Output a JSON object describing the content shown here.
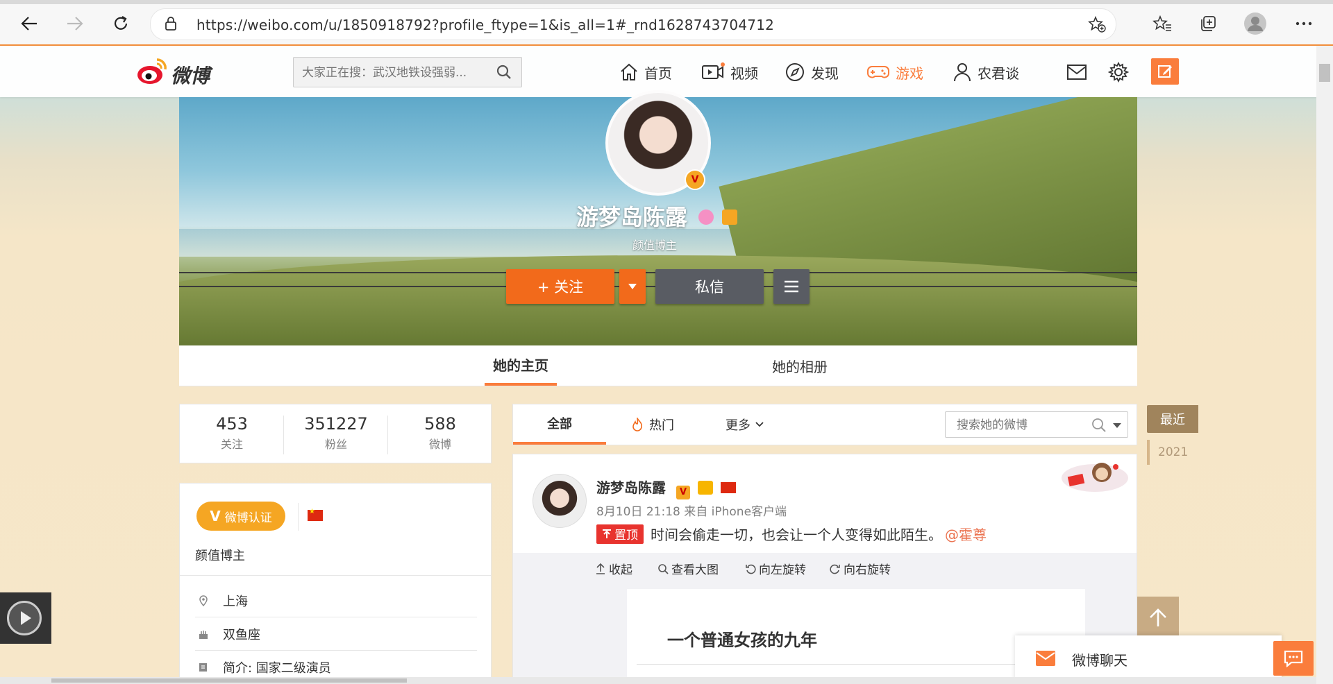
{
  "browser": {
    "url": "https://weibo.com/u/1850918792?profile_ftype=1&is_all=1#_rnd1628743704712"
  },
  "header": {
    "logo_text": "微博",
    "search_placeholder": "大家正在搜：武汉地铁设强弱...",
    "nav": {
      "home": "首页",
      "video": "视频",
      "discover": "发现",
      "game": "游戏",
      "user": "农君谈"
    },
    "accent_color": "#fa7d3c"
  },
  "profile": {
    "name": "游梦岛陈露",
    "subtitle": "颜值博主",
    "follow_label": "+ 关注",
    "message_label": "私信",
    "tabs": {
      "home": "她的主页",
      "album": "她的相册"
    }
  },
  "stats": {
    "following": {
      "num": "453",
      "label": "关注"
    },
    "followers": {
      "num": "351227",
      "label": "粉丝"
    },
    "posts": {
      "num": "588",
      "label": "微博"
    }
  },
  "info": {
    "verify_label": "微博认证",
    "description": "颜值博主",
    "location": "上海",
    "zodiac": "双鱼座",
    "bio": "简介:   国家二级演员"
  },
  "feed": {
    "tabs": {
      "all": "全部",
      "hot": "热门",
      "more": "更多"
    },
    "search_placeholder": "搜索她的微博",
    "timeline": {
      "recent": "最近",
      "year": "2021"
    }
  },
  "post": {
    "author": "游梦岛陈露",
    "meta": "8月10日 21:18 来自 iPhone客户端",
    "pin_label": "置顶",
    "text": "时间会偷走一切，也会让一个人变得如此陌生。",
    "mention": "@霍尊",
    "tools": {
      "collapse": "收起",
      "view_large": "查看大图",
      "rotate_left": "向左旋转",
      "rotate_right": "向右旋转"
    },
    "article_title": "一个普通女孩的九年"
  },
  "chat": {
    "label": "微博聊天"
  }
}
